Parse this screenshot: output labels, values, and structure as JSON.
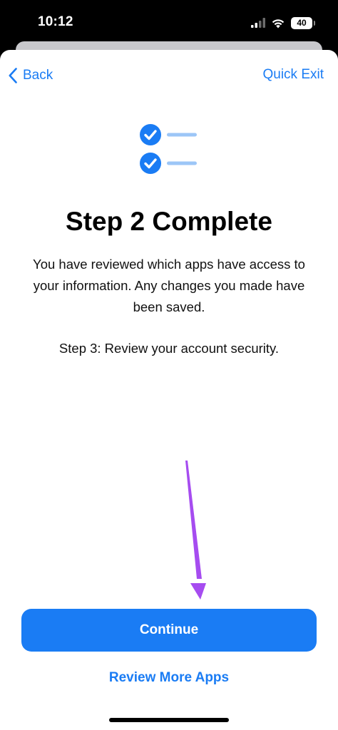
{
  "status_bar": {
    "time": "10:12",
    "battery": "40",
    "icons": [
      "cellular-signal-icon",
      "wifi-icon",
      "battery-icon"
    ]
  },
  "nav": {
    "back_label": "Back",
    "exit_label": "Quick Exit"
  },
  "content": {
    "title": "Step 2 Complete",
    "description": "You have reviewed which apps have access to your information. Any changes you made have been saved.",
    "next_step": "Step 3: Review your account security."
  },
  "actions": {
    "continue_label": "Continue",
    "review_label": "Review More Apps"
  },
  "colors": {
    "accent": "#1a7cf4",
    "annotation_arrow": "#a64cf0",
    "background": "#ffffff"
  }
}
